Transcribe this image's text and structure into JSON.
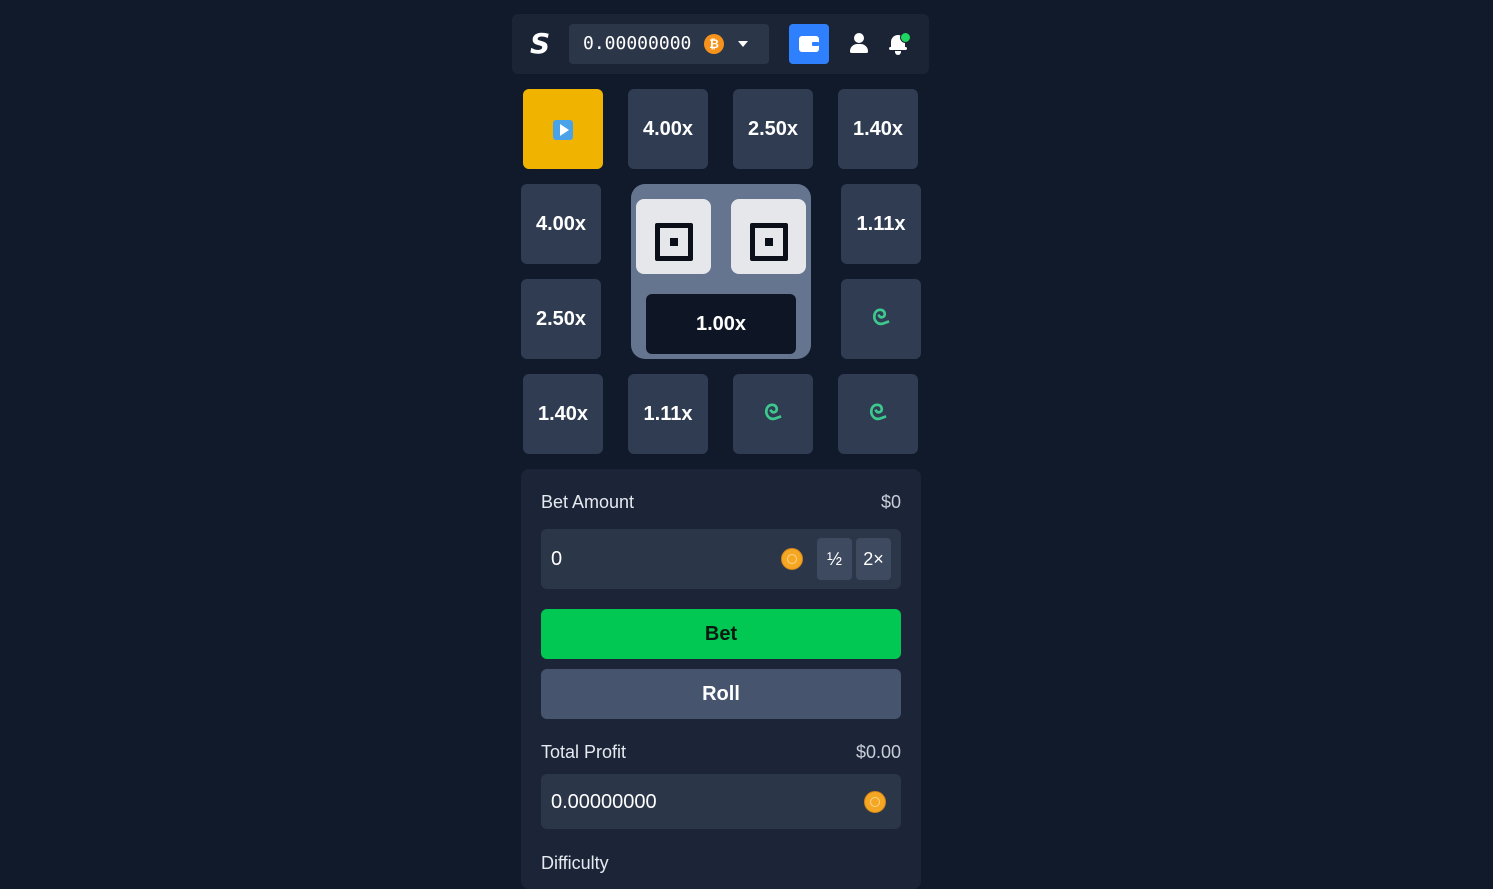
{
  "header": {
    "logo": "S",
    "balance": "0.00000000",
    "currency_icon": "bitcoin-icon",
    "notification_dot_color": "#1ed760"
  },
  "board": {
    "start_tile_icon": "play-icon",
    "tiles": {
      "top_1": "4.00x",
      "top_2": "2.50x",
      "top_3": "1.40x",
      "left_1": "4.00x",
      "left_2": "2.50x",
      "right_1": "1.11x",
      "right_2_icon": "snake-icon",
      "bottom_1": "1.40x",
      "bottom_2": "1.11x",
      "bottom_3_icon": "snake-icon",
      "bottom_4_icon": "snake-icon"
    },
    "dice": [
      1,
      1
    ],
    "current_multiplier": "1.00x"
  },
  "bet_panel": {
    "bet_amount_label": "Bet Amount",
    "bet_amount_usd": "$0",
    "bet_amount_value": "0",
    "half_label": "½",
    "double_label": "2×",
    "bet_button": "Bet",
    "roll_button": "Roll",
    "total_profit_label": "Total Profit",
    "total_profit_usd": "$0.00",
    "total_profit_value": "0.00000000",
    "difficulty_label": "Difficulty"
  },
  "colors": {
    "background": "#111a2b",
    "start_tile": "#f0b400",
    "bet_button": "#00c853",
    "wallet_button": "#2f80ff",
    "snake": "#3dc98e"
  }
}
